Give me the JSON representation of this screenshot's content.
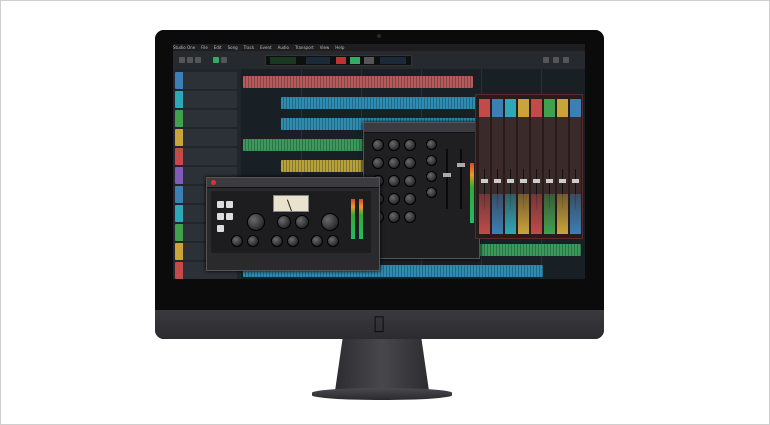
{
  "page": {
    "frame": "product-photo",
    "background": "#ffffff"
  },
  "device": {
    "name": "iMac",
    "logo_icon": "apple-logo-icon"
  },
  "daw": {
    "menubar": [
      "Studio One",
      "File",
      "Edit",
      "Song",
      "Track",
      "Event",
      "Audio",
      "Transport",
      "View",
      "Help"
    ],
    "track_colors": [
      "#3b7fb5",
      "#2ea7b8",
      "#3fa14e",
      "#c9a43b",
      "#c24a4a",
      "#7e5bb8",
      "#3b7fb5",
      "#2ea7b8",
      "#3fa14e",
      "#c9a43b",
      "#c24a4a"
    ],
    "lane_colors": [
      "#b85a5a",
      "#2e8cb0",
      "#2e8cb0",
      "#3a9a5a",
      "#b8a23a",
      "#7a5ab0",
      "#2e8cb0",
      "#b8a23a",
      "#3a9a5a",
      "#2e8cb0"
    ],
    "mixer_strip_colors": [
      "#c24a4a",
      "#3b7fb5",
      "#2ea7b8",
      "#c9a43b",
      "#c24a4a",
      "#3fa14e",
      "#c9a43b",
      "#3b7fb5"
    ]
  }
}
